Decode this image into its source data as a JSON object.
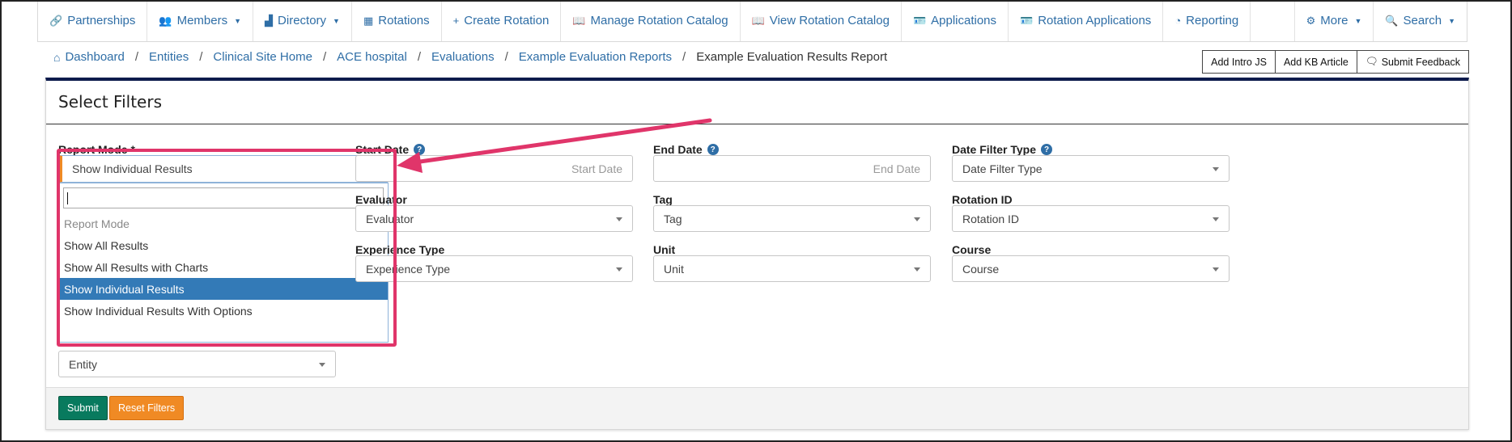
{
  "nav": {
    "items": [
      {
        "icon": "link-icon",
        "glyph": "🔗",
        "label": "Partnerships",
        "caret": false
      },
      {
        "icon": "users-icon",
        "glyph": "👥",
        "label": "Members",
        "caret": true
      },
      {
        "icon": "sitemap-icon",
        "glyph": "▟",
        "label": "Directory",
        "caret": true
      },
      {
        "icon": "table-icon",
        "glyph": "▦",
        "label": "Rotations",
        "caret": false
      },
      {
        "icon": "plus-icon",
        "glyph": "+",
        "label": "Create Rotation",
        "caret": false
      },
      {
        "icon": "book-icon",
        "glyph": "📖",
        "label": "Manage Rotation Catalog",
        "caret": false
      },
      {
        "icon": "book-open-icon",
        "glyph": "📖",
        "label": "View Rotation Catalog",
        "caret": false
      },
      {
        "icon": "id-card-icon",
        "glyph": "🪪",
        "label": "Applications",
        "caret": false
      },
      {
        "icon": "id-card-icon",
        "glyph": "🪪",
        "label": "Rotation Applications",
        "caret": false
      },
      {
        "icon": "dashboard-icon",
        "glyph": "◔",
        "label": "Reporting",
        "caret": false
      }
    ],
    "more_label": "More",
    "search_label": "Search"
  },
  "breadcrumb": {
    "items": [
      "Dashboard",
      "Entities",
      "Clinical Site Home",
      "ACE hospital",
      "Evaluations",
      "Example Evaluation Reports"
    ],
    "current": "Example Evaluation Results Report"
  },
  "tools": {
    "intro_js": "Add Intro JS",
    "kb_article": "Add KB Article",
    "feedback": "Submit Feedback"
  },
  "filters": {
    "title": "Select Filters",
    "report_mode": {
      "label": "Report Mode *",
      "value": "Show Individual Results",
      "options": [
        {
          "label": "Report Mode",
          "state": "disabled"
        },
        {
          "label": "Show All Results",
          "state": "normal"
        },
        {
          "label": "Show All Results with Charts",
          "state": "normal"
        },
        {
          "label": "Show Individual Results",
          "state": "selected"
        },
        {
          "label": "Show Individual Results With Options",
          "state": "normal"
        }
      ]
    },
    "start_date": {
      "label": "Start Date",
      "placeholder": "Start Date"
    },
    "end_date": {
      "label": "End Date",
      "placeholder": "End Date"
    },
    "date_filter_type": {
      "label": "Date Filter Type",
      "placeholder": "Date Filter Type"
    },
    "evaluator": {
      "label": "Evaluator",
      "placeholder": "Evaluator"
    },
    "tag": {
      "label": "Tag",
      "placeholder": "Tag"
    },
    "rotation_id": {
      "label": "Rotation ID",
      "placeholder": "Rotation ID"
    },
    "experience_type": {
      "label": "Experience Type",
      "placeholder": "Experience Type"
    },
    "unit": {
      "label": "Unit",
      "placeholder": "Unit"
    },
    "course": {
      "label": "Course",
      "placeholder": "Course"
    },
    "entity": {
      "placeholder": "Entity"
    }
  },
  "actions": {
    "submit": "Submit",
    "reset": "Reset Filters"
  },
  "colors": {
    "link": "#2f6ea6",
    "selected": "#337ab7",
    "submit": "#087a5e",
    "reset": "#f08a24",
    "highlight": "#e0356a"
  }
}
